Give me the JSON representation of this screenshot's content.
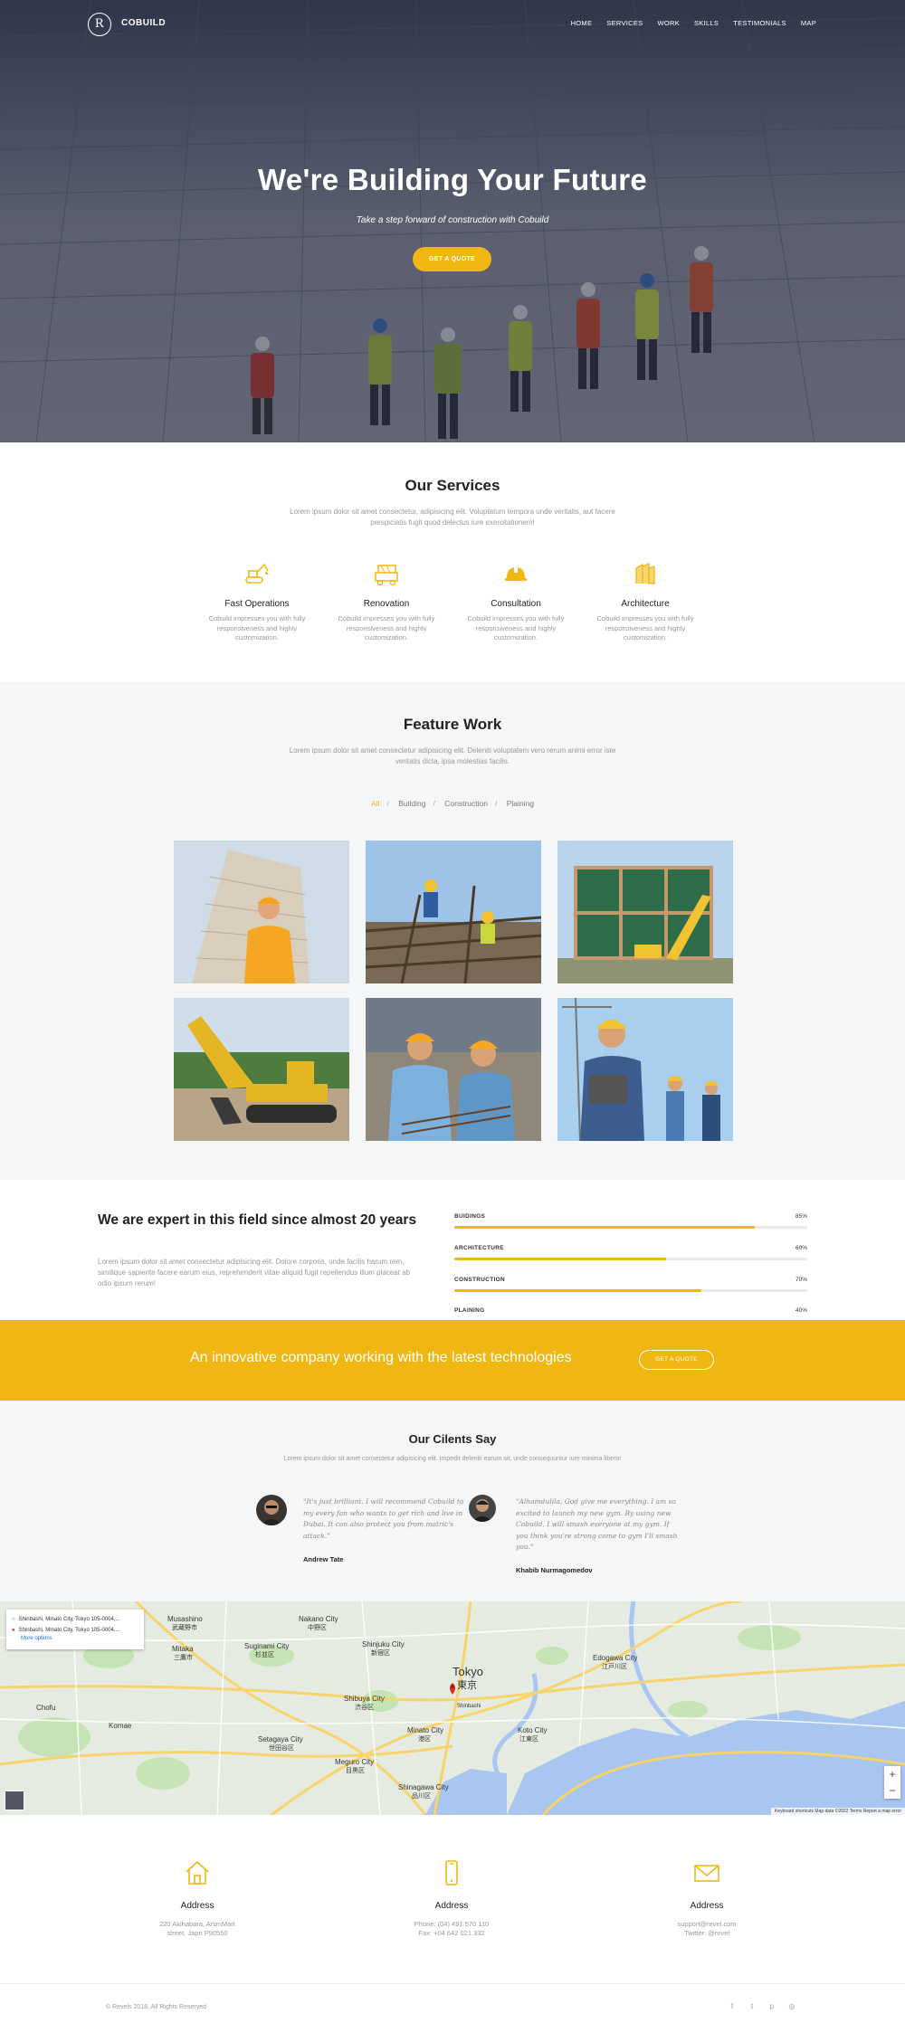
{
  "brand": {
    "logo_letter": "R",
    "name": "COBUILD"
  },
  "nav": {
    "items": [
      "HOME",
      "SERVICES",
      "WORK",
      "SKILLS",
      "TESTIMONIALS",
      "MAP"
    ]
  },
  "hero": {
    "title": "We're Building Your Future",
    "subtitle": "Take a step forward of construction with Cobuild",
    "button": "GET A QUOTE"
  },
  "services": {
    "title": "Our Services",
    "description": "Lorem ipsum dolor sit amet consectetur, adipisicing elit. Voluptatum tempora unde veritatis, aut facere perspiciatis fugit quod delectus iure exercitationem!",
    "items": [
      {
        "name": "Fast Operations",
        "text": "Cobuild impresses you with fully responsiveness and highly customization.",
        "icon": "excavator-icon"
      },
      {
        "name": "Renovation",
        "text": "Cobuild impresses you with fully responsiveness and highly customization.",
        "icon": "crane-truck-icon"
      },
      {
        "name": "Consultation",
        "text": "Cobuild impresses you with fully responsiveness and highly customization.",
        "icon": "hard-hat-icon"
      },
      {
        "name": "Architecture",
        "text": "Cobuild impresses you with fully responsiveness and highly customization.",
        "icon": "building-icon"
      }
    ]
  },
  "feature": {
    "title": "Feature Work",
    "description": "Lorem ipsum dolor sit amet consectetur adipisicing elit. Deleniti voluptatem vero rerum animi error iste veritatis dicta, ipsa molestias facilis.",
    "filters": [
      "All",
      "Building",
      "Construction",
      "Plaining"
    ],
    "active_filter": "All"
  },
  "expert": {
    "title": "We are expert in this field since almost 20 years",
    "text": "Lorem ipsum dolor sit amet consectetur adipisicing elit. Dolore corporis, unde facilis harum rem, similique sapiente facere earum eius, reprehenderit vitae aliquid fugit repellendus illum placeat ab odio ipsum rerum!",
    "skills": [
      {
        "label": "BUIDINGS",
        "percent": "85%",
        "value": 85
      },
      {
        "label": "ARCHITECTURE",
        "percent": "60%",
        "value": 60
      },
      {
        "label": "CONSTRUCTION",
        "percent": "70%",
        "value": 70
      },
      {
        "label": "PLAINING",
        "percent": "40%",
        "value": 40
      }
    ]
  },
  "banner": {
    "text": "An innovative company working with the latest technologies",
    "button": "GET A QUOTE"
  },
  "clients": {
    "title": "Our Cilents Say",
    "description": "Lorem ipsum dolor sit amet consectetur adipisicing elit. Impedit deleniti earum sit, unde consequuntur iure minima libero!",
    "items": [
      {
        "quote": "\"It's just brilliant. I will recommend Cobuild to my every fan who wants to get rich and live in Dubai. It can also protect you from matric's attack.\"",
        "author": "Andrew Tate"
      },
      {
        "quote": "\"Alhamdulila, God give me everything. I am so excited to launch my new gym. By using new Cobuild, I will smash everyone at my gym. If you think you're strong come to gym I'll smash you.\"",
        "author": "Khabib Nurmagomedov"
      }
    ]
  },
  "map": {
    "origin": "Shinbashi, Minato City, Tokyo 105-0004,...",
    "destination": "Shinbashi, Minato City, Tokyo 105-0004,...",
    "more_options": "More options",
    "zoom_in": "+",
    "zoom_out": "−",
    "footer": "Keyboard shortcuts   Map data ©2022   Terms   Report a map error",
    "labels": [
      "Nakano City",
      "中野区",
      "Shinjuku City",
      "新宿区",
      "Suginami City",
      "杉並区",
      "Shibuya City",
      "渋谷区",
      "Setagaya City",
      "世田谷区",
      "Meguro City",
      "目黒区",
      "Minato City",
      "港区",
      "Shinagawa City",
      "品川区",
      "Tokyo",
      "東京",
      "Koto City",
      "江東区",
      "Edogawa City",
      "江戸川区",
      "Musashino",
      "武蔵野市",
      "Mitaka",
      "三鷹市",
      "Chofu",
      "Komae",
      "Shinbashi"
    ]
  },
  "contact": [
    {
      "title": "Address",
      "lines": [
        "220 Akihabara, AnimMart",
        "street, Japn P90550"
      ],
      "icon": "home-icon"
    },
    {
      "title": "Address",
      "lines": [
        "Phone: (04) 491 570 110",
        "Fax: +04 642 021 332"
      ],
      "icon": "phone-icon"
    },
    {
      "title": "Address",
      "lines": [
        "support@revel.com",
        "Twitter: @revel"
      ],
      "icon": "mail-icon"
    }
  ],
  "footer": {
    "copyright": "© Revels 2018. All Rights Reserved",
    "socials": [
      {
        "icon": "facebook-icon",
        "glyph": "f"
      },
      {
        "icon": "twitter-icon",
        "glyph": "t"
      },
      {
        "icon": "pinterest-icon",
        "glyph": "p"
      },
      {
        "icon": "instagram-icon",
        "glyph": "◎"
      }
    ]
  },
  "colors": {
    "accent": "#f0b712",
    "hero_overlay": "#1e243c",
    "light_bg": "#f5f6f8"
  }
}
